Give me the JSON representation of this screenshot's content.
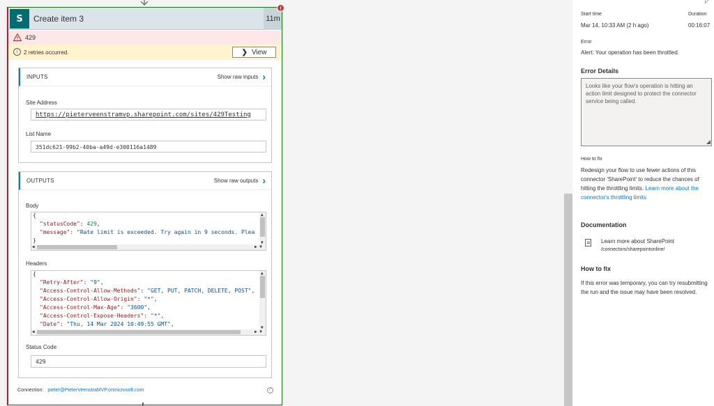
{
  "card": {
    "title": "Create item 3",
    "duration": "11m",
    "badge": "!",
    "error_code": "429",
    "retries_text": "2 retries occurred.",
    "view_label": "View",
    "connection_label": "Connection:",
    "connection_account": "pieter@PieterVeenstraMVP.onmicrosoft.com"
  },
  "inputs": {
    "title": "INPUTS",
    "raw_link": "Show raw inputs",
    "site_address_label": "Site Address",
    "site_address_value": "https://pieterveenstramvp.sharepoint.com/sites/429Testing",
    "list_name_label": "List Name",
    "list_name_value": "351dc621-99b2-40ba-a49d-e300116a1489"
  },
  "outputs": {
    "title": "OUTPUTS",
    "raw_link": "Show raw outputs",
    "body_label": "Body",
    "body_lines": [
      {
        "t": "{"
      },
      {
        "k": "\"statusCode\"",
        "sep": ": ",
        "v": "429",
        "vt": "n",
        "end": ","
      },
      {
        "k": "\"message\"",
        "sep": ": ",
        "v": "\"Rate limit is exceeded. Try again in 9 seconds. Plea",
        "vt": "s2",
        "end": ""
      },
      {
        "t": "}"
      }
    ],
    "headers_label": "Headers",
    "header_lines": [
      {
        "t": "{"
      },
      {
        "k": "\"Retry-After\"",
        "sep": ": ",
        "v": "\"9\"",
        "end": ","
      },
      {
        "k": "\"Access-Control-Allow-Methods\"",
        "sep": ": ",
        "v": "\"GET, PUT, PATCH, DELETE, POST\"",
        "end": ","
      },
      {
        "k": "\"Access-Control-Allow-Origin\"",
        "sep": ": ",
        "v": "\"*\"",
        "end": ","
      },
      {
        "k": "\"Access-Control-Max-Age\"",
        "sep": ": ",
        "v": "\"3600\"",
        "end": ","
      },
      {
        "k": "\"Access-Control-Expose-Headers\"",
        "sep": ": ",
        "v": "\"*\"",
        "end": ","
      },
      {
        "k": "\"Date\"",
        "sep": ": ",
        "v": "\"Thu, 14 Mar 2024 10:49:55 GMT\"",
        "end": ","
      }
    ],
    "status_code_label": "Status Code",
    "status_code_value": "429"
  },
  "pane": {
    "start_time_label": "Start time",
    "start_time_value": "Mar 14, 10:33 AM (2 h ago)",
    "duration_label": "Duration",
    "duration_value": "00:16:07",
    "error_label": "Error",
    "error_value": "Alert: Your operation has been throttled.",
    "error_details_heading": "Error Details",
    "error_details_text": "Looks like your flow's operation is hitting an action limit designed to protect the connector service being called.",
    "how_to_fix_label": "How to fix",
    "how_to_fix_text": "Redesign your flow to use fewer actions of this connector 'SharePoint' to reduce the chances of hitting the throttling limits.",
    "how_to_fix_link": "Learn more about the connector's throttling limits",
    "documentation_heading": "Documentation",
    "doc_link_title": "Learn more about SharePoint",
    "doc_link_path": "/connectors/sharepointonline/",
    "how_to_fix_heading": "How to fix",
    "how_to_fix_body": "If this error was temporary, you can try resubmitting the run and the issue may have been resolved."
  },
  "icons": {
    "sharepoint": "sharepoint-icon",
    "warning": "warning-icon",
    "info": "info-icon",
    "chevron": "chevron-right-icon",
    "document": "document-icon",
    "check": "check-circle-icon",
    "arrow": "arrow-down-icon"
  },
  "colors": {
    "error_bg": "#fde7e9",
    "warn_bg": "#fff4ce",
    "accent": "#0078d4",
    "sharepoint": "#036c70",
    "error_badge": "#d13438"
  }
}
